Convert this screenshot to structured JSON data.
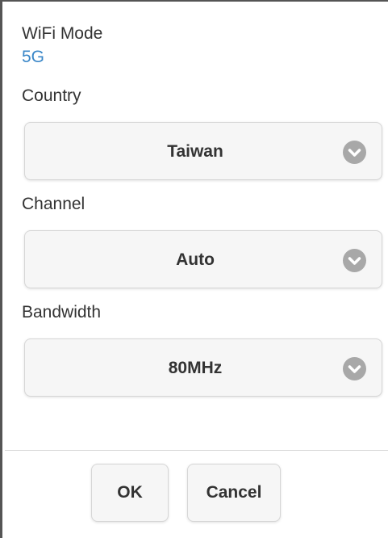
{
  "wifi_mode": {
    "label": "WiFi Mode",
    "value": "5G",
    "value_color": "#3a87c8"
  },
  "fields": [
    {
      "label": "Country",
      "value": "Taiwan",
      "icon": "chevron-down-circle-icon"
    },
    {
      "label": "Channel",
      "value": "Auto",
      "icon": "chevron-down-circle-icon"
    },
    {
      "label": "Bandwidth",
      "value": "80MHz",
      "icon": "chevron-down-circle-icon"
    }
  ],
  "buttons": {
    "ok_label": "OK",
    "cancel_label": "Cancel"
  },
  "colors": {
    "icon_circle": "#a8a8a8",
    "icon_chevron": "#ffffff"
  }
}
